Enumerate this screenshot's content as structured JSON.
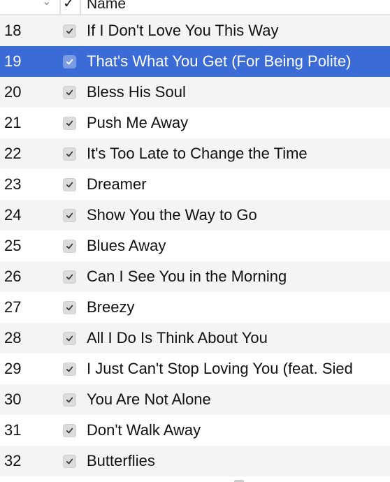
{
  "header": {
    "sort_icon": "chevron-down-icon",
    "check_column_label": "✓",
    "name_column_label": "Name"
  },
  "colors": {
    "selected_row": "#3b6bd6",
    "alt_row": "#f4f4f4",
    "row": "#ffffff"
  },
  "tracks": [
    {
      "number": "18",
      "checked": true,
      "name": "If I Don't Love You This Way",
      "selected": false
    },
    {
      "number": "19",
      "checked": true,
      "name": "That's What You Get (For Being Polite)",
      "selected": true
    },
    {
      "number": "20",
      "checked": true,
      "name": "Bless His Soul",
      "selected": false
    },
    {
      "number": "21",
      "checked": true,
      "name": "Push Me Away",
      "selected": false
    },
    {
      "number": "22",
      "checked": true,
      "name": "It's Too Late to Change the Time",
      "selected": false
    },
    {
      "number": "23",
      "checked": true,
      "name": "Dreamer",
      "selected": false
    },
    {
      "number": "24",
      "checked": true,
      "name": "Show You the Way to Go",
      "selected": false
    },
    {
      "number": "25",
      "checked": true,
      "name": "Blues Away",
      "selected": false
    },
    {
      "number": "26",
      "checked": true,
      "name": "Can I See You in the Morning",
      "selected": false
    },
    {
      "number": "27",
      "checked": true,
      "name": "Breezy",
      "selected": false
    },
    {
      "number": "28",
      "checked": true,
      "name": "All I Do Is Think About You",
      "selected": false
    },
    {
      "number": "29",
      "checked": true,
      "name": "I Just Can't Stop Loving You (feat. Sied",
      "selected": false
    },
    {
      "number": "30",
      "checked": true,
      "name": "You Are Not Alone",
      "selected": false
    },
    {
      "number": "31",
      "checked": true,
      "name": "Don't Walk Away",
      "selected": false
    },
    {
      "number": "32",
      "checked": true,
      "name": "Butterflies",
      "selected": false
    }
  ]
}
